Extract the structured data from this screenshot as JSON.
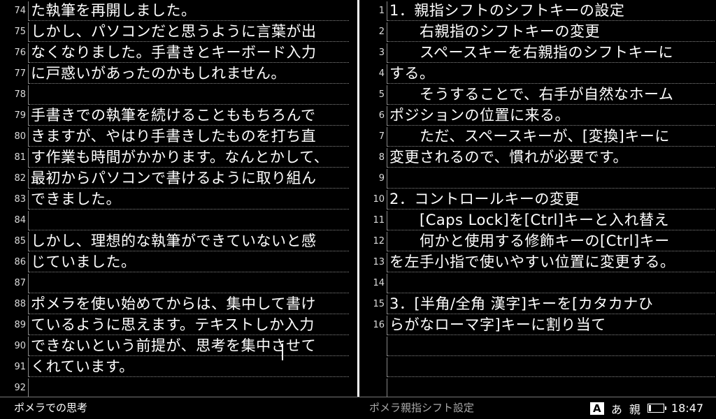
{
  "left_pane": {
    "lines": [
      {
        "num": "74",
        "text": "た執筆を再開しました。"
      },
      {
        "num": "75",
        "text": "しかし、パソコンだと思うように言葉が出"
      },
      {
        "num": "76",
        "text": "なくなりました。手書きとキーボード入力"
      },
      {
        "num": "77",
        "text": "に戸惑いがあったのかもしれません。"
      },
      {
        "num": "78",
        "text": ""
      },
      {
        "num": "79",
        "text": "手書きでの執筆を続けることももちろんで"
      },
      {
        "num": "80",
        "text": "きますが、やはり手書きしたものを打ち直"
      },
      {
        "num": "81",
        "text": "す作業も時間がかかります。なんとかして、"
      },
      {
        "num": "82",
        "text": "最初からパソコンで書けるように取り組ん"
      },
      {
        "num": "83",
        "text": "できました。"
      },
      {
        "num": "84",
        "text": ""
      },
      {
        "num": "85",
        "text": "しかし、理想的な執筆ができていないと感"
      },
      {
        "num": "86",
        "text": "じていました。"
      },
      {
        "num": "87",
        "text": ""
      },
      {
        "num": "88",
        "text": "ポメラを使い始めてからは、集中して書け"
      },
      {
        "num": "89",
        "text": "ているように思えます。テキストしか入力"
      },
      {
        "num": "90",
        "text": "できないという前提が、思考を集中させて"
      },
      {
        "num": "91",
        "text": "くれています。"
      },
      {
        "num": "92",
        "text": ""
      }
    ]
  },
  "right_pane": {
    "lines": [
      {
        "num": "1",
        "text": "1．親指シフトのシフトキーの設定"
      },
      {
        "num": "2",
        "text": "　　右親指のシフトキーの変更"
      },
      {
        "num": "3",
        "text": "　　スペースキーを右親指のシフトキーに"
      },
      {
        "num": "4",
        "text": "する。"
      },
      {
        "num": "5",
        "text": "　　そうすることで、右手が自然なホーム"
      },
      {
        "num": "6",
        "text": "ポジションの位置に来る。"
      },
      {
        "num": "7",
        "text": "　　ただ、スペースキーが、[変換]キーに"
      },
      {
        "num": "8",
        "text": "変更されるので、慣れが必要です。"
      },
      {
        "num": "9",
        "text": ""
      },
      {
        "num": "10",
        "text": "2．コントロールキーの変更"
      },
      {
        "num": "11",
        "text": "　　[Caps Lock]を[Ctrl]キーと入れ替え"
      },
      {
        "num": "12",
        "text": "　　何かと使用する修飾キーの[Ctrl]キー"
      },
      {
        "num": "13",
        "text": "を左手小指で使いやすい位置に変更する。"
      },
      {
        "num": "14",
        "text": ""
      },
      {
        "num": "15",
        "text": "3．[半角/全角 漢字]キーを[カタカナひ"
      },
      {
        "num": "16",
        "text": "らがなローマ字]キーに割り当て"
      },
      {
        "num": "",
        "text": ""
      },
      {
        "num": "",
        "text": ""
      },
      {
        "num": "",
        "text": ""
      }
    ]
  },
  "status_bar": {
    "left_doc_title": "ポメラでの思考",
    "right_doc_title": "ポメラ親指シフト設定",
    "input_mode_icon_glyph": "A",
    "kana_mode": "あ",
    "thumb_shift_mode": "親",
    "time": "18:47"
  }
}
